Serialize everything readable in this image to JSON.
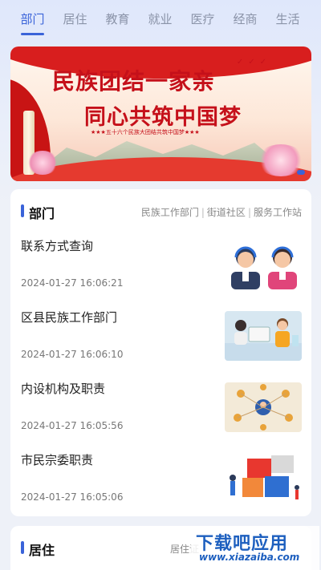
{
  "tabs": [
    {
      "label": "部门",
      "active": true
    },
    {
      "label": "居住",
      "active": false
    },
    {
      "label": "教育",
      "active": false
    },
    {
      "label": "就业",
      "active": false
    },
    {
      "label": "医疗",
      "active": false
    },
    {
      "label": "经商",
      "active": false
    },
    {
      "label": "生活",
      "active": false
    }
  ],
  "banner": {
    "title_line1": "民族团结一家亲",
    "title_line2": "同心共筑中国梦",
    "slogan": "★★★五十六个民族大团结共筑中国梦★★★"
  },
  "section_department": {
    "title": "部门",
    "links": [
      "民族工作部门",
      "街道社区",
      "服务工作站"
    ],
    "items": [
      {
        "name": "联系方式查询",
        "time": "2024-01-27 16:06:21",
        "icon": "customer-service-image"
      },
      {
        "name": "区县民族工作部门",
        "time": "2024-01-27 16:06:10",
        "icon": "office-workers-image"
      },
      {
        "name": "内设机构及职责",
        "time": "2024-01-27 16:05:56",
        "icon": "organization-network-image"
      },
      {
        "name": "市民宗委职责",
        "time": "2024-01-27 16:05:06",
        "icon": "responsibility-blocks-image"
      }
    ]
  },
  "section_residence": {
    "title": "居住",
    "links_partial": "居住证"
  },
  "watermark": {
    "text": "下载吧应用",
    "url": "www.xiazaiba.com"
  },
  "colors": {
    "accent": "#3a63d9",
    "banner_red": "#c5101a"
  }
}
